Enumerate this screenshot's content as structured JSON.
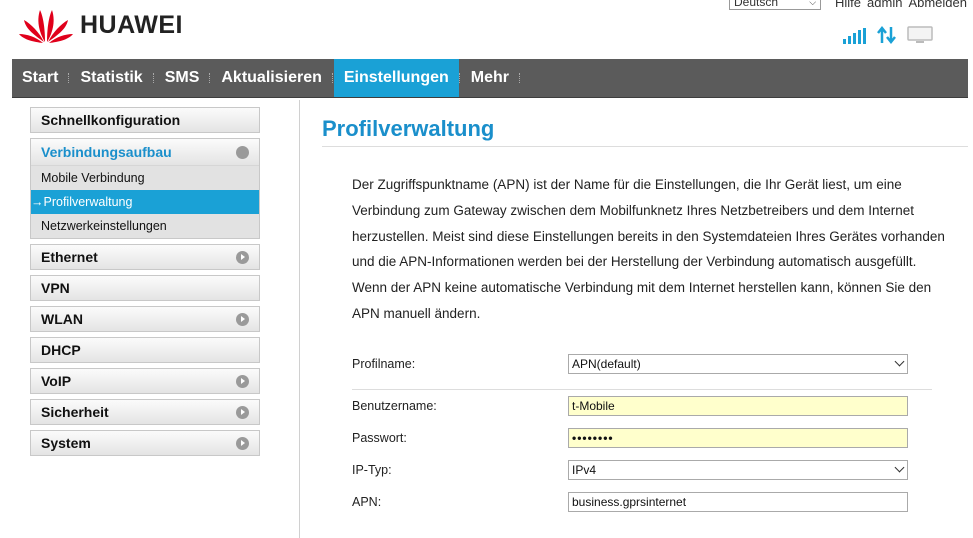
{
  "header": {
    "brand": "HUAWEI",
    "language": "Deutsch",
    "links": [
      "Hilfe",
      "admin",
      "Abmelden"
    ]
  },
  "nav": {
    "items": [
      {
        "label": "Start"
      },
      {
        "label": "Statistik"
      },
      {
        "label": "SMS"
      },
      {
        "label": "Aktualisieren"
      },
      {
        "label": "Einstellungen",
        "active": true
      },
      {
        "label": "Mehr"
      }
    ]
  },
  "sidebar": {
    "schnellkonfiguration": "Schnellkonfiguration",
    "verbindungsaufbau": {
      "label": "Verbindungsaufbau",
      "subitems": [
        "Mobile Verbindung",
        "→Profilverwaltung",
        "Netzwerkeinstellungen"
      ]
    },
    "items": [
      "Ethernet",
      "VPN",
      "WLAN",
      "DHCP",
      "VoIP",
      "Sicherheit",
      "System"
    ]
  },
  "main": {
    "title": "Profilverwaltung",
    "description": "Der Zugriffspunktname (APN) ist der Name für die Einstellungen, die Ihr Gerät liest, um eine Verbindung zum Gateway zwischen dem Mobilfunknetz Ihres Netzbetreibers und dem Internet herzustellen. Meist sind diese Einstellungen bereits in den Systemdateien Ihres Gerätes vorhanden und die APN-Informationen werden bei der Herstellung der Verbindung automatisch ausgefüllt. Wenn der APN keine automatische Verbindung mit dem Internet herstellen kann, können Sie den APN manuell ändern.",
    "form": {
      "profile_label": "Profilname:",
      "profile_value": "APN(default)",
      "user_label": "Benutzername:",
      "user_value": "t-Mobile",
      "password_label": "Passwort:",
      "password_value": "••••••••",
      "iptype_label": "IP-Typ:",
      "iptype_value": "IPv4",
      "apn_label": "APN:",
      "apn_value": "business.gprsinternet"
    }
  },
  "colors": {
    "accent": "#1aa1d6",
    "nav_bg": "#5b5b5b",
    "title": "#1a8fcb",
    "field_highlight": "#ffffcc",
    "brand_red": "#e0001b"
  }
}
